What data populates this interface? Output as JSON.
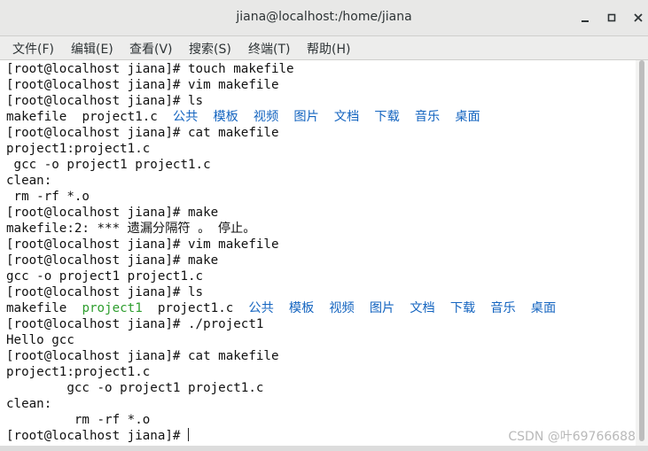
{
  "window": {
    "title": "jiana@localhost:/home/jiana"
  },
  "menu": [
    "文件(F)",
    "编辑(E)",
    "查看(V)",
    "搜索(S)",
    "终端(T)",
    "帮助(H)"
  ],
  "terminal": {
    "lines": [
      "[root@localhost jiana]# touch makefile",
      "[root@localhost jiana]# vim makefile",
      "[root@localhost jiana]# ls",
      "ls1",
      "[root@localhost jiana]# cat makefile",
      "project1:project1.c",
      " gcc -o project1 project1.c",
      "clean:",
      " rm -rf *.o",
      "[root@localhost jiana]# make",
      "makefile:2: *** 遗漏分隔符 。 停止。",
      "[root@localhost jiana]# vim makefile",
      "[root@localhost jiana]# make",
      "gcc -o project1 project1.c",
      "[root@localhost jiana]# ls",
      "ls2",
      "[root@localhost jiana]# ./project1",
      "Hello gcc",
      "[root@localhost jiana]# cat makefile",
      "project1:project1.c",
      "        gcc -o project1 project1.c",
      "clean:",
      "         rm -rf *.o",
      "[root@localhost jiana]# "
    ],
    "ls1": [
      "makefile",
      "project1.c"
    ],
    "ls2": [
      "makefile",
      "project1",
      "project1.c"
    ],
    "dirs": [
      "公共",
      "模板",
      "视频",
      "图片",
      "文档",
      "下载",
      "音乐",
      "桌面"
    ],
    "colors": {
      "text": "#111111",
      "directory": "#1565c0",
      "executable": "#2e9e2e"
    }
  },
  "watermark": "CSDN @叶69766688"
}
